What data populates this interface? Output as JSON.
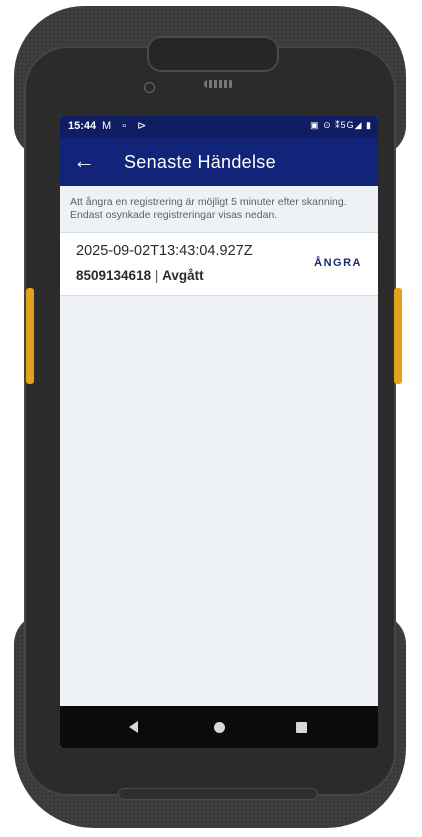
{
  "status_bar": {
    "time": "15:44",
    "left_icons": "M ▫ ⊳",
    "right_icons": "▣ ⊙ ⁑5G◢ ▮",
    "network": "5G"
  },
  "app_bar": {
    "back_icon": "←",
    "title": "Senaste Händelse"
  },
  "info_text": "Att ångra en registrering är möjligt 5 minuter efter skanning. Endast osynkade registreringar visas nedan.",
  "events": [
    {
      "timestamp": "2025-09-02T13:43:04.927Z",
      "id": "8509134618",
      "separator": " | ",
      "status": "Avgått",
      "undo_label": "ÅNGRA"
    }
  ],
  "colors": {
    "status_bar": "#0f1e63",
    "app_bar": "#12247a",
    "background": "#eef2f7",
    "undo_text": "#1b2c6b",
    "side_keys": "#e0a21a"
  },
  "nav_bar": {
    "icons": [
      "back-triangle",
      "home-circle",
      "recents-square"
    ]
  }
}
